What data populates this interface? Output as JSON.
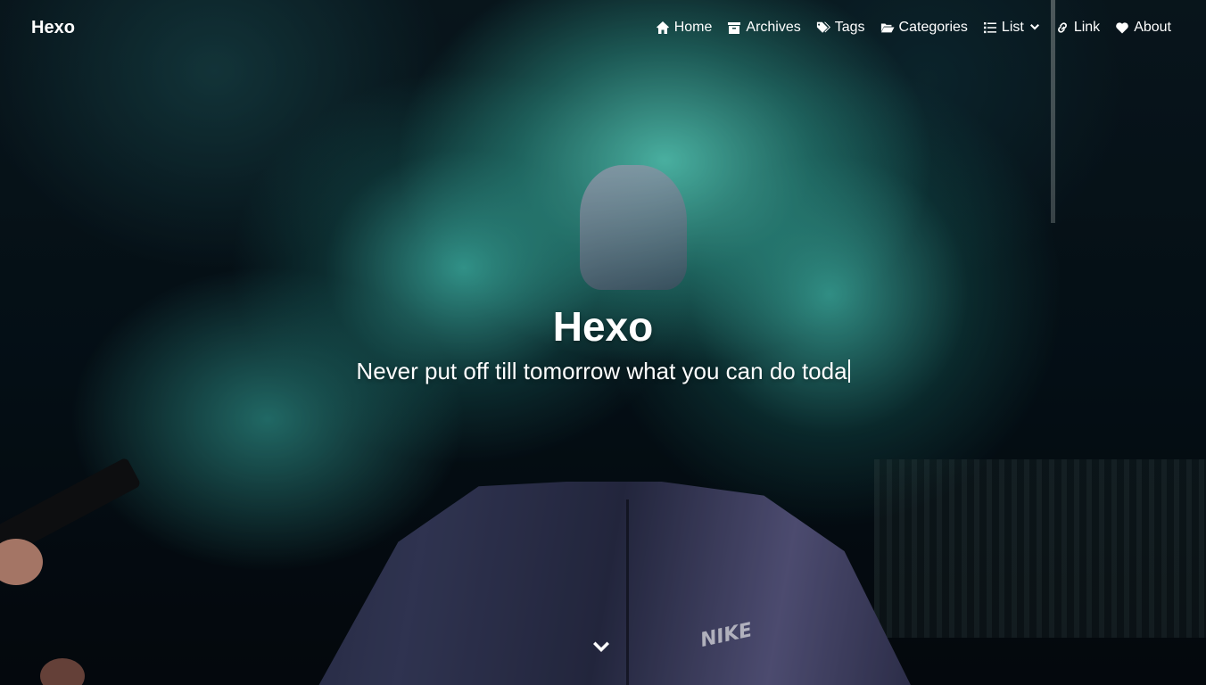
{
  "nav": {
    "site_name": "Hexo",
    "menus": [
      {
        "label": "Home",
        "icon": "home-icon"
      },
      {
        "label": "Archives",
        "icon": "archive-icon"
      },
      {
        "label": "Tags",
        "icon": "tags-icon"
      },
      {
        "label": "Categories",
        "icon": "folder-open-icon"
      },
      {
        "label": "List",
        "icon": "list-icon"
      },
      {
        "label": "Link",
        "icon": "link-icon"
      },
      {
        "label": "About",
        "icon": "heart-icon"
      }
    ]
  },
  "hero": {
    "title": "Hexo",
    "subtitle": "Never put off till tomorrow what you can do toda",
    "scroll_icon": "chevron-down-icon",
    "colors": {
      "smoke": "#5ee0cc",
      "background": "#06121a",
      "text": "#ffffff"
    }
  }
}
